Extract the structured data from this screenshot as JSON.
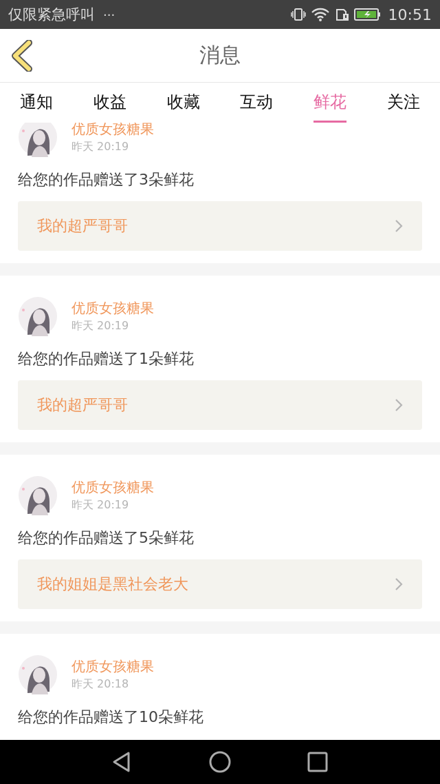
{
  "status_bar": {
    "carrier": "仅限紧急呼叫",
    "more": "···",
    "time": "10:51"
  },
  "header": {
    "title": "消息"
  },
  "tabs": [
    {
      "label": "通知",
      "selected": false
    },
    {
      "label": "收益",
      "selected": false
    },
    {
      "label": "收藏",
      "selected": false
    },
    {
      "label": "互动",
      "selected": false
    },
    {
      "label": "鲜花",
      "selected": true
    },
    {
      "label": "关注",
      "selected": false
    }
  ],
  "messages": [
    {
      "user": "优质女孩糖果",
      "time": "昨天 20:19",
      "text": "给您的作品赠送了3朵鲜花",
      "work": "我的超严哥哥"
    },
    {
      "user": "优质女孩糖果",
      "time": "昨天 20:19",
      "text": "给您的作品赠送了1朵鲜花",
      "work": "我的超严哥哥"
    },
    {
      "user": "优质女孩糖果",
      "time": "昨天 20:19",
      "text": "给您的作品赠送了5朵鲜花",
      "work": "我的姐姐是黑社会老大"
    },
    {
      "user": "优质女孩糖果",
      "time": "昨天 20:18",
      "text": "给您的作品赠送了10朵鲜花"
    }
  ]
}
